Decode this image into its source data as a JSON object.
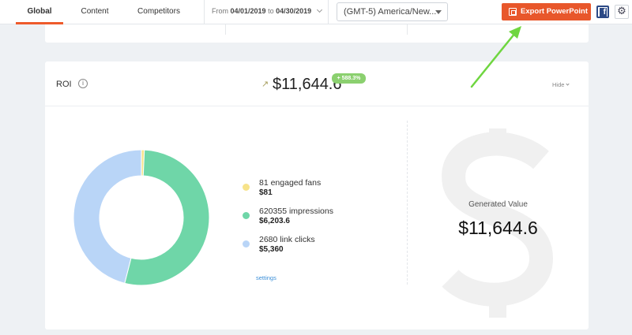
{
  "nav": {
    "tabs": [
      {
        "label": "Global"
      },
      {
        "label": "Content"
      },
      {
        "label": "Competitors"
      }
    ]
  },
  "date_range": {
    "from_label": "From",
    "from": "04/01/2019",
    "to_label": "to",
    "to": "04/30/2019"
  },
  "timezone": {
    "selected": "(GMT-5) America/New..."
  },
  "toolbar": {
    "export_label": "Export PowerPoint",
    "facebook_icon": "facebook-icon",
    "settings_icon": "gear-icon"
  },
  "roi": {
    "title": "ROI",
    "trend_icon": "trend-up-arrow-icon",
    "total": "$11,644.6",
    "change": "+ 588.3%",
    "hide_label": "Hide",
    "legend": [
      {
        "label": "81 engaged fans",
        "value": "$81",
        "amount": 81,
        "color": "#f7e38a"
      },
      {
        "label": "620355 impressions",
        "value": "$6,203.6",
        "amount": 6203.6,
        "color": "#6fd6a8"
      },
      {
        "label": "2680 link clicks",
        "value": "$5,360",
        "amount": 5360,
        "color": "#b9d5f7"
      }
    ],
    "settings_label": "settings",
    "generated_value_label": "Generated Value",
    "generated_value": "$11,644.6"
  },
  "colors": {
    "accent": "#e8572b",
    "active_tab": "#ee5a2b",
    "badge": "#8bd06f",
    "link": "#3b8fd8",
    "annotation_arrow": "#6fd640"
  }
}
